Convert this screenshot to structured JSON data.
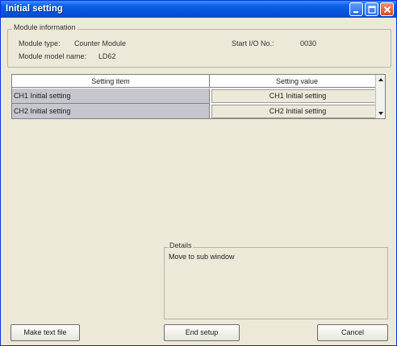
{
  "window": {
    "title": "Initial setting",
    "controls": {
      "minimize": "minimize-icon",
      "maximize": "maximize-icon",
      "close": "close-icon"
    }
  },
  "module_info": {
    "legend": "Module information",
    "type_label": "Module type:",
    "type_value": "Counter Module",
    "model_label": "Module model name:",
    "model_value": "LD62",
    "start_io_label": "Start I/O No.:",
    "start_io_value": "0030"
  },
  "grid": {
    "headers": [
      "Setting item",
      "Setting value"
    ],
    "rows": [
      {
        "item": "CH1 Initial setting",
        "value": "CH1 Initial setting"
      },
      {
        "item": "CH2 Initial setting",
        "value": "CH2 Initial setting"
      }
    ]
  },
  "details": {
    "legend": "Details",
    "text": "Move to sub window"
  },
  "buttons": {
    "make_text_file": "Make text file",
    "end_setup": "End setup",
    "cancel": "Cancel"
  },
  "colors": {
    "titlebar": "#0553dc",
    "window_bg": "#ece9d8",
    "row_item_bg": "#c6c7ce"
  }
}
